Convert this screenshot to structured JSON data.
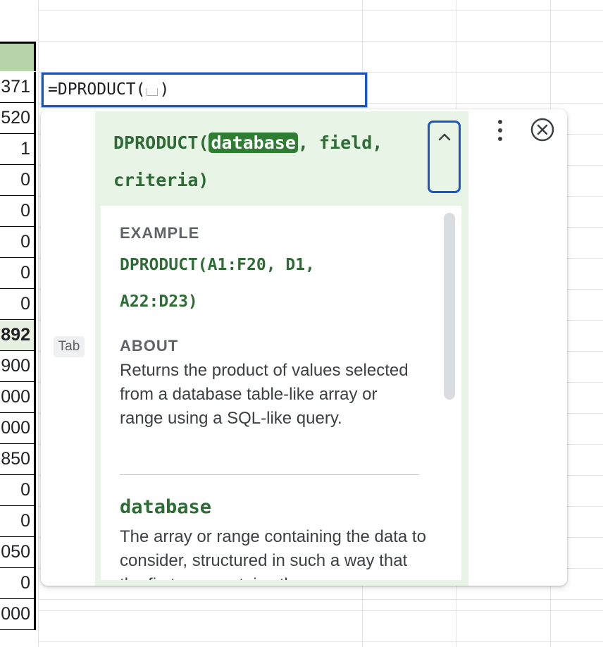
{
  "column_cells": [
    "371",
    "520",
    "1",
    "0",
    "0",
    "0",
    "0",
    "0",
    "892",
    "900",
    "000",
    "000",
    "850",
    "0",
    "0",
    "050",
    "0",
    "000"
  ],
  "editor": {
    "prefix": "=DPRODUCT(",
    "suffix": ")"
  },
  "help": {
    "signature": {
      "fn_open": "DPRODUCT(",
      "active_arg": "database",
      "rest_line1": ", field,",
      "rest_line2": "criteria)"
    },
    "example_label": "EXAMPLE",
    "example_line1": "DPRODUCT(A1:F20, D1,",
    "example_line2": "A22:D23)",
    "about_label": "ABOUT",
    "about_text": "Returns the product of values selected from a database table-like array or range using a SQL-like query.",
    "param_name": "database",
    "param_desc": "The array or range containing the data to consider, structured in such a way that the first row contains the",
    "tab_hint": "Tab"
  },
  "colors": {
    "accent_blue": "#1a56c4",
    "panel_green": "#e8f4e6",
    "code_green": "#2e6b35",
    "header_green": "#b7d3a8"
  },
  "icons": [
    "chevron-up-icon",
    "more-vert-icon",
    "close-circle-icon"
  ]
}
